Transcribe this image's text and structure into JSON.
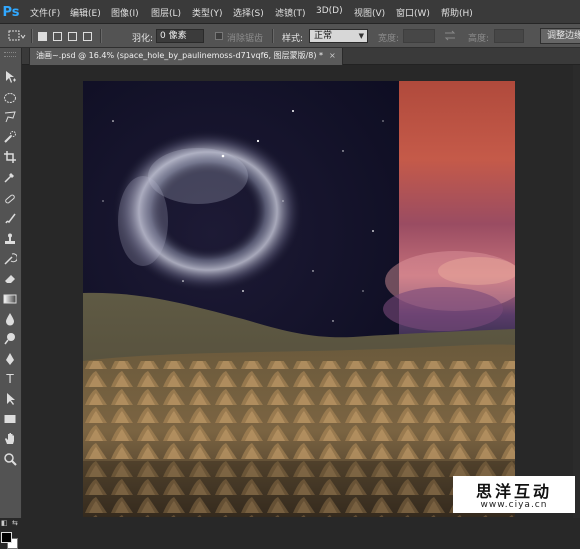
{
  "app": {
    "logo": "Ps",
    "menu": [
      "文件(F)",
      "编辑(E)",
      "图像(I)",
      "图层(L)",
      "类型(Y)",
      "选择(S)",
      "滤镜(T)",
      "3D(D)",
      "视图(V)",
      "窗口(W)",
      "帮助(H)"
    ]
  },
  "options": {
    "feather_label": "羽化:",
    "feather_value": "0 像素",
    "antialias_label": "消除锯齿",
    "style_label": "样式:",
    "style_value": "正常",
    "width_label": "宽度:",
    "height_label": "高度:",
    "refine_edge_button": "调整边缘"
  },
  "document": {
    "tab_title": "油画~.psd @ 16.4% (space_hole_by_paulinemoss-d71vqf6, 图层蒙版/8) *",
    "close_glyph": "×"
  },
  "tools": [
    "move-tool",
    "marquee-tool",
    "lasso-tool",
    "quick-selection-tool",
    "crop-tool",
    "eyedropper-tool",
    "spot-healing-tool",
    "brush-tool",
    "clone-stamp-tool",
    "history-brush-tool",
    "eraser-tool",
    "gradient-tool",
    "blur-tool",
    "dodge-tool",
    "pen-tool",
    "type-tool",
    "path-selection-tool",
    "rectangle-tool",
    "hand-tool",
    "zoom-tool"
  ],
  "tool_glyphs": {
    "type-tool": "T"
  },
  "colors": {
    "foreground": "#000000",
    "background": "#ffffff",
    "accent": "#31a8ff"
  },
  "watermark": {
    "title": "思洋互动",
    "url": "www.ciya.cn"
  }
}
